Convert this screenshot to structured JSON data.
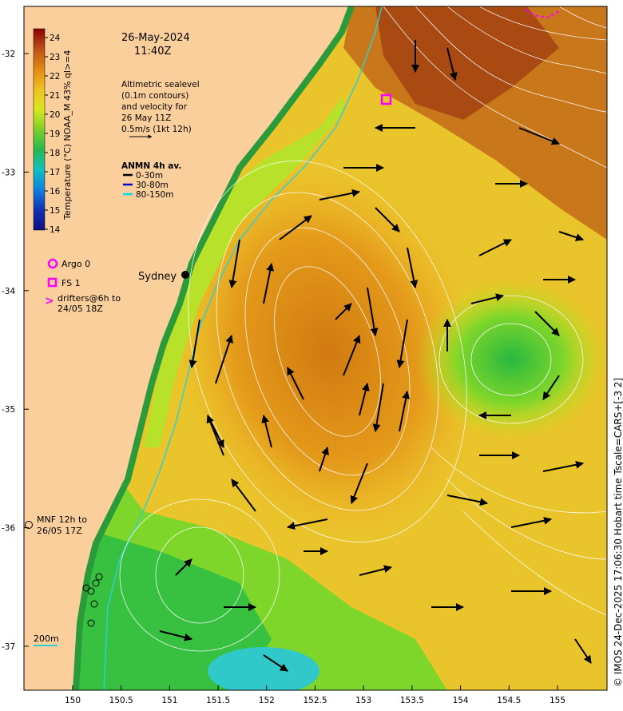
{
  "map": {
    "date": "26-May-2024",
    "time": "11:40Z",
    "sealevel_note": [
      "Altimetric sealevel",
      "(0.1m contours)",
      "and velocity for",
      "26 May 11Z",
      "0.5m/s (1kt 12h)"
    ],
    "anmn": {
      "title": "ANMN 4h av.",
      "items": [
        {
          "label": "0-30m",
          "color": "#000000"
        },
        {
          "label": "30-80m",
          "color": "#0000cc"
        },
        {
          "label": "80-150m",
          "color": "#00e0e0"
        }
      ]
    },
    "place": "Sydney",
    "legend": {
      "argo": "Argo 0",
      "fs": "FS 1",
      "drifters": [
        "drifters@6h to",
        "24/05 18Z"
      ],
      "mnf": [
        "MNF 12h to",
        "26/05 17Z"
      ]
    },
    "isobath": "200m",
    "colorbar": {
      "title": "Temperature (°C) NOAA_M 43% ql>=4",
      "ticks": [
        "24",
        "23",
        "22",
        "21",
        "20",
        "19",
        "18",
        "17",
        "16",
        "15",
        "14"
      ]
    },
    "lat_ticks": [
      "-32",
      "-33",
      "-34",
      "-35",
      "-36",
      "-37"
    ],
    "lon_ticks": [
      "150",
      "150.5",
      "151",
      "151.5",
      "152",
      "152.5",
      "153",
      "153.5",
      "154",
      "154.5",
      "155"
    ],
    "credit": "© IMOS 24-Dec-2025 17:06:30 Hobart time Tscale=CARS+[-3 2]",
    "colors": {
      "land": "#fbcf9c",
      "warm": "#d98a12",
      "hot": "#b34a0a",
      "cool": "#9ee31f",
      "cold": "#1fb83a",
      "highlight": "#ff00ff",
      "shelf": "#30d0d0"
    }
  }
}
